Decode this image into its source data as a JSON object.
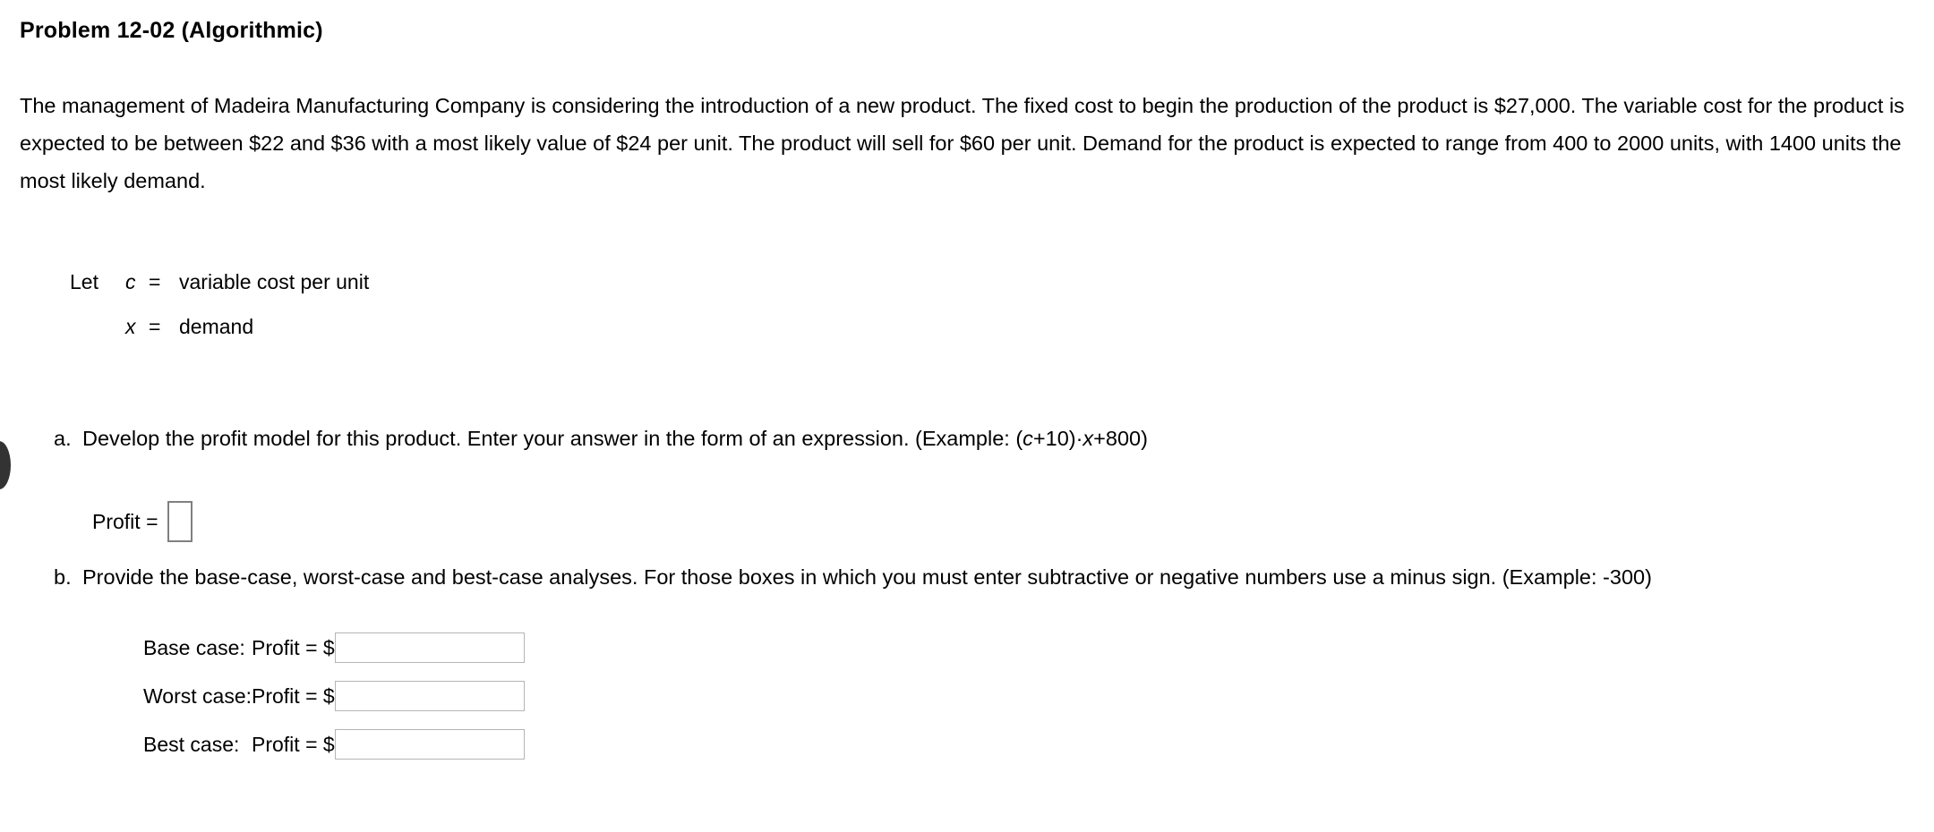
{
  "page": {
    "title": "Problem 12-02 (Algorithmic)",
    "intro": "The management of Madeira Manufacturing Company is considering the introduction of a new product. The fixed cost to begin the production of the product is $27,000. The variable cost for the product is expected to be between $22 and $36 with a most likely value of $24 per unit. The product will sell for $60 per unit. Demand for the product is expected to range from 400 to 2000 units, with 1400 units the most likely demand."
  },
  "definitions": {
    "keyword": "Let",
    "rows": [
      {
        "symbol": "c",
        "equals": "=",
        "meaning": "variable cost per unit"
      },
      {
        "symbol": "x",
        "equals": "=",
        "meaning": "demand"
      }
    ]
  },
  "part_a": {
    "letter": "a.",
    "text_before_example": "Develop the profit model for this product. Enter your answer in the form of an expression. (Example: (",
    "example_var1": "c",
    "example_mid": "+10)·",
    "example_var2": "x",
    "example_tail": "+800)",
    "profit_label": "Profit =",
    "answer_value": "",
    "answer_placeholder": ""
  },
  "part_b": {
    "letter": "b.",
    "text": "Provide the base-case, worst-case and best-case analyses. For those boxes in which you must enter subtractive or negative numbers use a minus sign. (Example: -300)",
    "rows": [
      {
        "label": "Base case:",
        "profit": "Profit = $",
        "value": "",
        "placeholder": ""
      },
      {
        "label": "Worst case:",
        "profit": "Profit = $",
        "value": "",
        "placeholder": ""
      },
      {
        "label": "Best case:",
        "profit": "Profit = $",
        "value": "",
        "placeholder": ""
      }
    ]
  },
  "colors": {
    "text": "#000000",
    "background": "#ffffff",
    "box_border_small": "#808080",
    "box_border_wide": "#b5b5b5",
    "arc": "#333333"
  }
}
